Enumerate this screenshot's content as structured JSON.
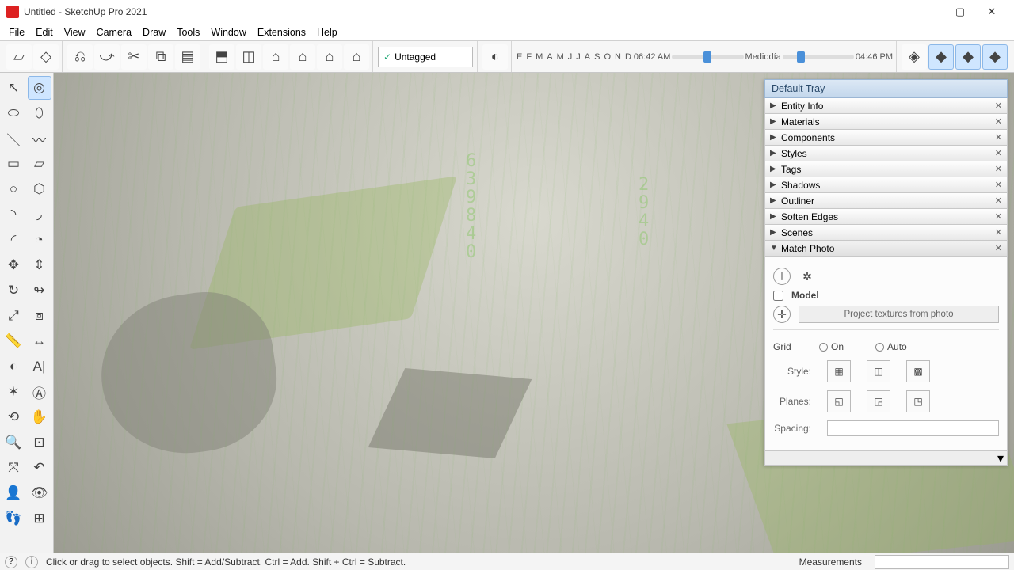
{
  "window": {
    "title": "Untitled - SketchUp Pro 2021"
  },
  "menu": [
    "File",
    "Edit",
    "View",
    "Camera",
    "Draw",
    "Tools",
    "Window",
    "Extensions",
    "Help"
  ],
  "tag_dropdown": {
    "label": "Untagged"
  },
  "shadow": {
    "months": [
      "E",
      "F",
      "M",
      "A",
      "M",
      "J",
      "J",
      "A",
      "S",
      "O",
      "N",
      "D"
    ],
    "time_left": "06:42 AM",
    "noon": "Mediodía",
    "time_right": "04:46 PM"
  },
  "tray": {
    "title": "Default Tray",
    "panels": [
      {
        "label": "Entity Info",
        "expanded": false
      },
      {
        "label": "Materials",
        "expanded": false
      },
      {
        "label": "Components",
        "expanded": false
      },
      {
        "label": "Styles",
        "expanded": false
      },
      {
        "label": "Tags",
        "expanded": false
      },
      {
        "label": "Shadows",
        "expanded": false
      },
      {
        "label": "Outliner",
        "expanded": false
      },
      {
        "label": "Soften Edges",
        "expanded": false
      },
      {
        "label": "Scenes",
        "expanded": false
      },
      {
        "label": "Match Photo",
        "expanded": true
      }
    ],
    "match_photo": {
      "model_checkbox": "Model",
      "project_btn": "Project textures from photo",
      "grid_label": "Grid",
      "grid_on": "On",
      "grid_auto": "Auto",
      "style_label": "Style:",
      "planes_label": "Planes:",
      "spacing_label": "Spacing:"
    }
  },
  "status": {
    "hint": "Click or drag to select objects. Shift = Add/Subtract. Ctrl = Add. Shift + Ctrl = Subtract.",
    "measurements_label": "Measurements"
  }
}
